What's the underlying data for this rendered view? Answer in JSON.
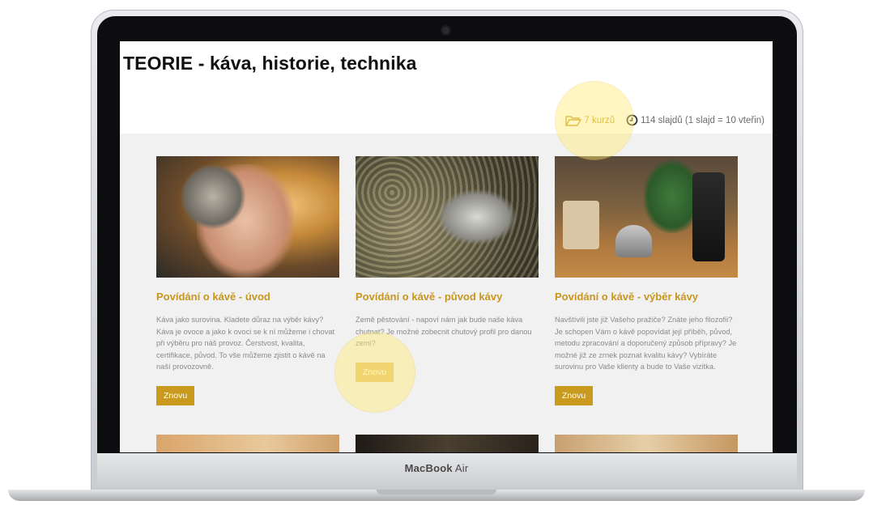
{
  "page": {
    "title": "TEORIE - káva, historie, technika",
    "courses_label": "7 kurzů",
    "slides_label": "114 slajdů (1 slajd = 10 vteřin)"
  },
  "cards": [
    {
      "title": "Povídání o kávě - úvod",
      "text": "Káva jako surovina. Kladete důraz na výběr kávy? Káva je ovoce a jako k ovoci se k ní můžeme i chovat při výběru pro náš provoz. Čerstvost, kvalita, certifikace, původ. To vše můžeme zjistit o kávě na naší provozovně.",
      "button": "Znovu"
    },
    {
      "title": "Povídání o kávě - původ kávy",
      "text": "Země pěstování - napoví nám jak bude naše káva chutnat? Je možné zobecnit chutový profil pro danou zemi?",
      "button": "Znovu"
    },
    {
      "title": "Povídání o kávě - výběr kávy",
      "text": "Navštívili jste již Vašeho pražiče? Znáte jeho filozofii? Je schopen Vám o kávě popovídat její příběh, původ, metodu zpracování a doporučený způsob přípravy? Je možné již ze zrnek poznat kvalitu kávy? Vybíráte surovinu pro Vaše klienty a bude to Vaše vizitka.",
      "button": "Znovu"
    }
  ],
  "device": {
    "label_bold": "MacBook",
    "label": "Air"
  },
  "colors": {
    "accent": "#c99a1e",
    "content_bg": "#f1f1f1",
    "text_muted": "#8a8a8a"
  },
  "icons": {
    "courses": "folder-open-icon",
    "slides": "clock-icon"
  }
}
